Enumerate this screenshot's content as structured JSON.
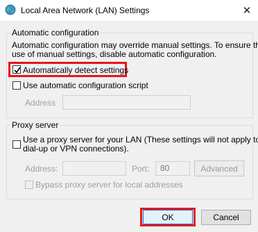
{
  "window": {
    "title": "Local Area Network (LAN) Settings",
    "close_glyph": "✕"
  },
  "automatic_config": {
    "group_title": "Automatic configuration",
    "description_line1": "Automatic configuration may override manual settings.  To ensure the",
    "description_line2": "use of manual settings, disable automatic configuration.",
    "auto_detect": {
      "label": "Automatically detect settings",
      "checked": true
    },
    "use_script": {
      "label": "Use automatic configuration script",
      "checked": false
    },
    "address_label": "Address",
    "address_value": ""
  },
  "proxy": {
    "group_title": "Proxy server",
    "use_proxy_line1": "Use a proxy server for your LAN (These settings will not apply to",
    "use_proxy_line2": "dial-up or VPN connections).",
    "use_proxy_checked": false,
    "address_label": "Address:",
    "address_value": "",
    "port_label": "Port:",
    "port_value": "80",
    "advanced_label": "Advanced",
    "bypass_label": "Bypass proxy server for local addresses",
    "bypass_checked": false
  },
  "buttons": {
    "ok_label": "OK",
    "cancel_label": "Cancel"
  },
  "colors": {
    "highlight": "#e8141b",
    "background": "#f0f0f0"
  },
  "icons": {
    "title": "network-globe-icon",
    "close": "close-icon",
    "check": "checkmark-icon"
  }
}
